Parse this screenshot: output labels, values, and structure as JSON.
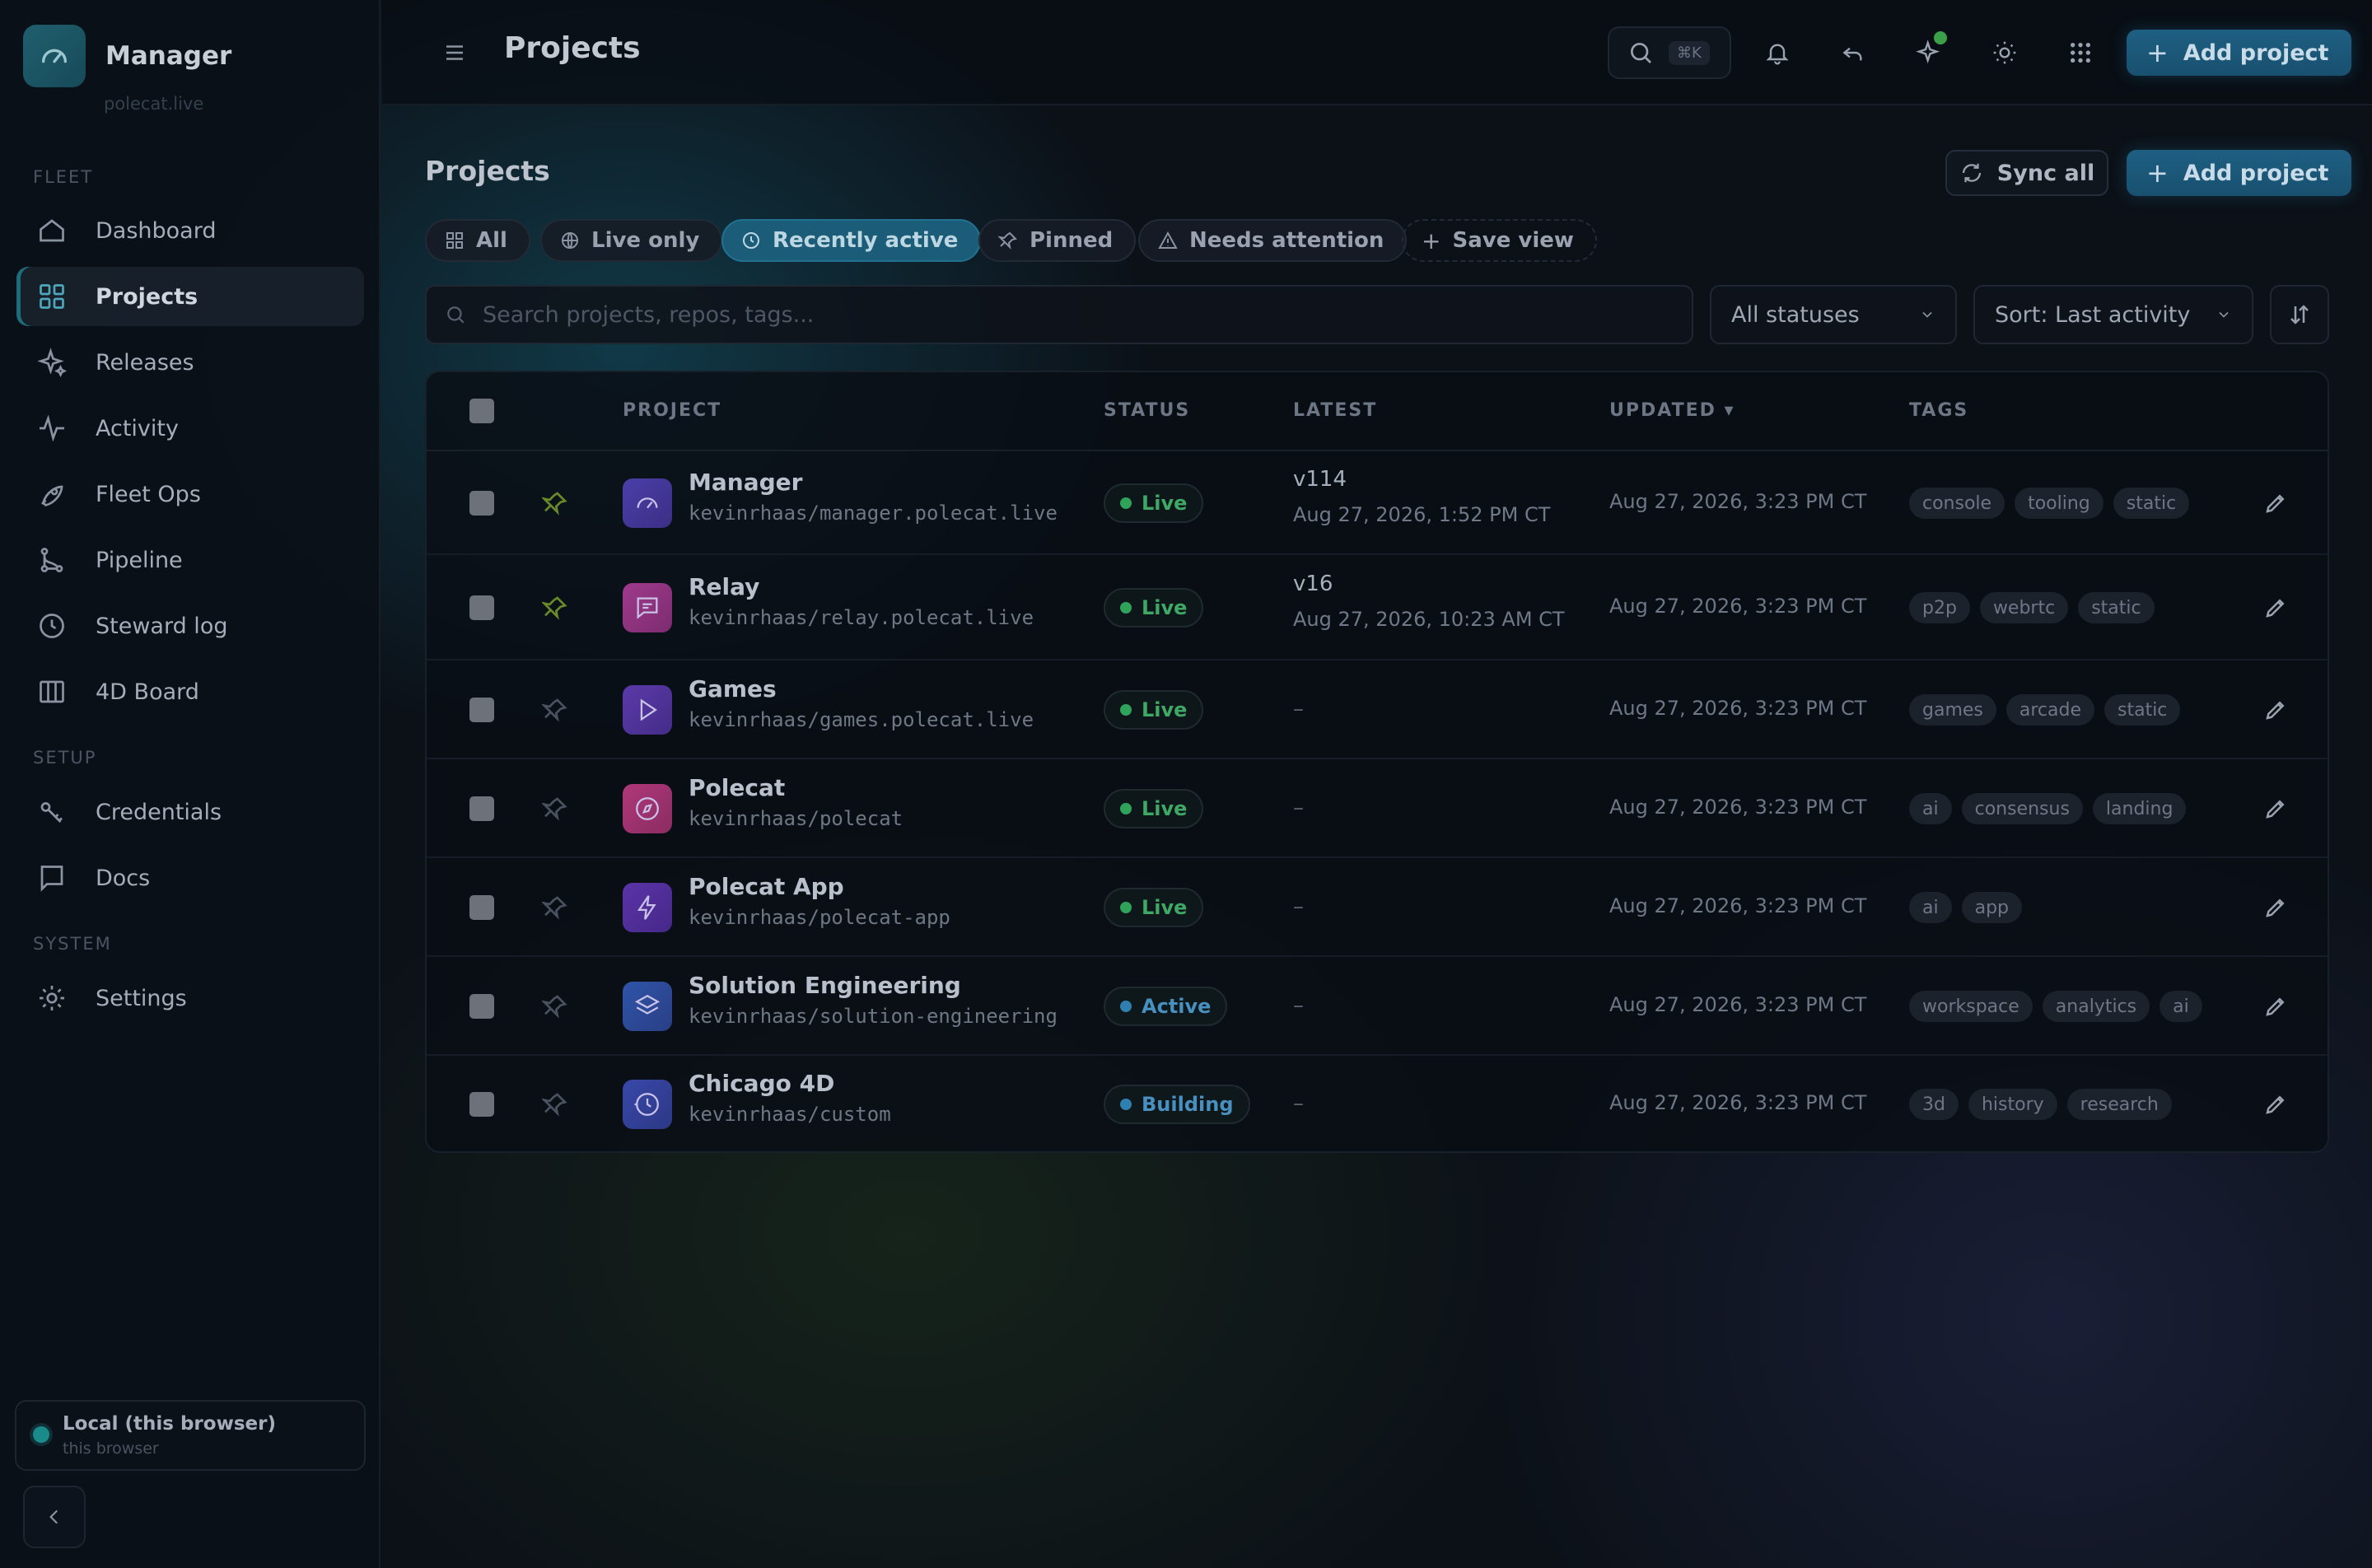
{
  "app": {
    "name": "Manager",
    "subtitle": "polecat.live"
  },
  "sidebar": {
    "sections": [
      {
        "label": "FLEET"
      },
      {
        "label": "SETUP"
      },
      {
        "label": "SYSTEM"
      }
    ],
    "items": [
      {
        "label": "Dashboard",
        "icon": "home-icon",
        "active": false
      },
      {
        "label": "Projects",
        "icon": "grid-icon",
        "active": true
      },
      {
        "label": "Releases",
        "icon": "sparkles-icon",
        "active": false
      },
      {
        "label": "Activity",
        "icon": "activity-icon",
        "active": false
      },
      {
        "label": "Fleet Ops",
        "icon": "rocket-icon",
        "active": false
      },
      {
        "label": "Pipeline",
        "icon": "git-branch-icon",
        "active": false
      },
      {
        "label": "Steward log",
        "icon": "clock-icon",
        "active": false
      },
      {
        "label": "4D Board",
        "icon": "columns-icon",
        "active": false
      },
      {
        "label": "Credentials",
        "icon": "key-icon",
        "active": false
      },
      {
        "label": "Docs",
        "icon": "message-square-icon",
        "active": false
      },
      {
        "label": "Settings",
        "icon": "gear-icon",
        "active": false
      }
    ],
    "local": {
      "title": "Local (this browser)",
      "subtitle": "this browser"
    }
  },
  "topbar": {
    "title": "Projects",
    "search_shortcut": "⌘K",
    "add_project_label": "Add project"
  },
  "content": {
    "heading": "Projects",
    "sync_label": "Sync all",
    "add_project_label": "Add project",
    "filters": [
      {
        "label": "All",
        "active": false
      },
      {
        "label": "Live only",
        "active": false
      },
      {
        "label": "Recently active",
        "active": true
      },
      {
        "label": "Pinned",
        "active": false
      },
      {
        "label": "Needs attention",
        "active": false
      },
      {
        "label": "Save view",
        "active": false
      }
    ],
    "search_placeholder": "Search projects, repos, tags...",
    "status_select": "All statuses",
    "sort_select": "Sort: Last activity"
  },
  "table": {
    "columns": {
      "project": "PROJECT",
      "status": "STATUS",
      "latest": "LATEST",
      "updated": "UPDATED ▾",
      "tags": "TAGS"
    },
    "rows": [
      {
        "name": "Manager",
        "repo": "kevinrhaas/manager.polecat.live",
        "status": "Live",
        "latest_version": "v114",
        "latest_date": "Aug 27, 2026, 1:52 PM CT",
        "updated": "Aug 27, 2026, 3:23 PM CT",
        "tags": [
          "console",
          "tooling",
          "static"
        ],
        "pinned": true,
        "icon": "gauge-icon"
      },
      {
        "name": "Relay",
        "repo": "kevinrhaas/relay.polecat.live",
        "status": "Live",
        "latest_version": "v16",
        "latest_date": "Aug 27, 2026, 10:23 AM CT",
        "updated": "Aug 27, 2026, 3:23 PM CT",
        "tags": [
          "p2p",
          "webrtc",
          "static"
        ],
        "pinned": true,
        "icon": "chat-icon"
      },
      {
        "name": "Games",
        "repo": "kevinrhaas/games.polecat.live",
        "status": "Live",
        "latest_version": "–",
        "latest_date": "",
        "updated": "Aug 27, 2026, 3:23 PM CT",
        "tags": [
          "games",
          "arcade",
          "static"
        ],
        "pinned": false,
        "icon": "play-icon"
      },
      {
        "name": "Polecat",
        "repo": "kevinrhaas/polecat",
        "status": "Live",
        "latest_version": "–",
        "latest_date": "",
        "updated": "Aug 27, 2026, 3:23 PM CT",
        "tags": [
          "ai",
          "consensus",
          "landing"
        ],
        "pinned": false,
        "icon": "compass-icon"
      },
      {
        "name": "Polecat App",
        "repo": "kevinrhaas/polecat-app",
        "status": "Live",
        "latest_version": "–",
        "latest_date": "",
        "updated": "Aug 27, 2026, 3:23 PM CT",
        "tags": [
          "ai",
          "app"
        ],
        "pinned": false,
        "icon": "bolt-icon"
      },
      {
        "name": "Solution Engineering",
        "repo": "kevinrhaas/solution-engineering",
        "status": "Active",
        "latest_version": "–",
        "latest_date": "",
        "updated": "Aug 27, 2026, 3:23 PM CT",
        "tags": [
          "workspace",
          "analytics",
          "ai"
        ],
        "pinned": false,
        "icon": "layers-icon"
      },
      {
        "name": "Chicago 4D",
        "repo": "kevinrhaas/custom",
        "status": "Building",
        "latest_version": "–",
        "latest_date": "",
        "updated": "Aug 27, 2026, 3:23 PM CT",
        "tags": [
          "3d",
          "history",
          "research"
        ],
        "pinned": false,
        "icon": "history-icon"
      }
    ]
  },
  "colors": {
    "accent": "#1b5c78",
    "live": "#2fa35a",
    "active": "#2f7fb0",
    "building": "#2f7fb0"
  }
}
